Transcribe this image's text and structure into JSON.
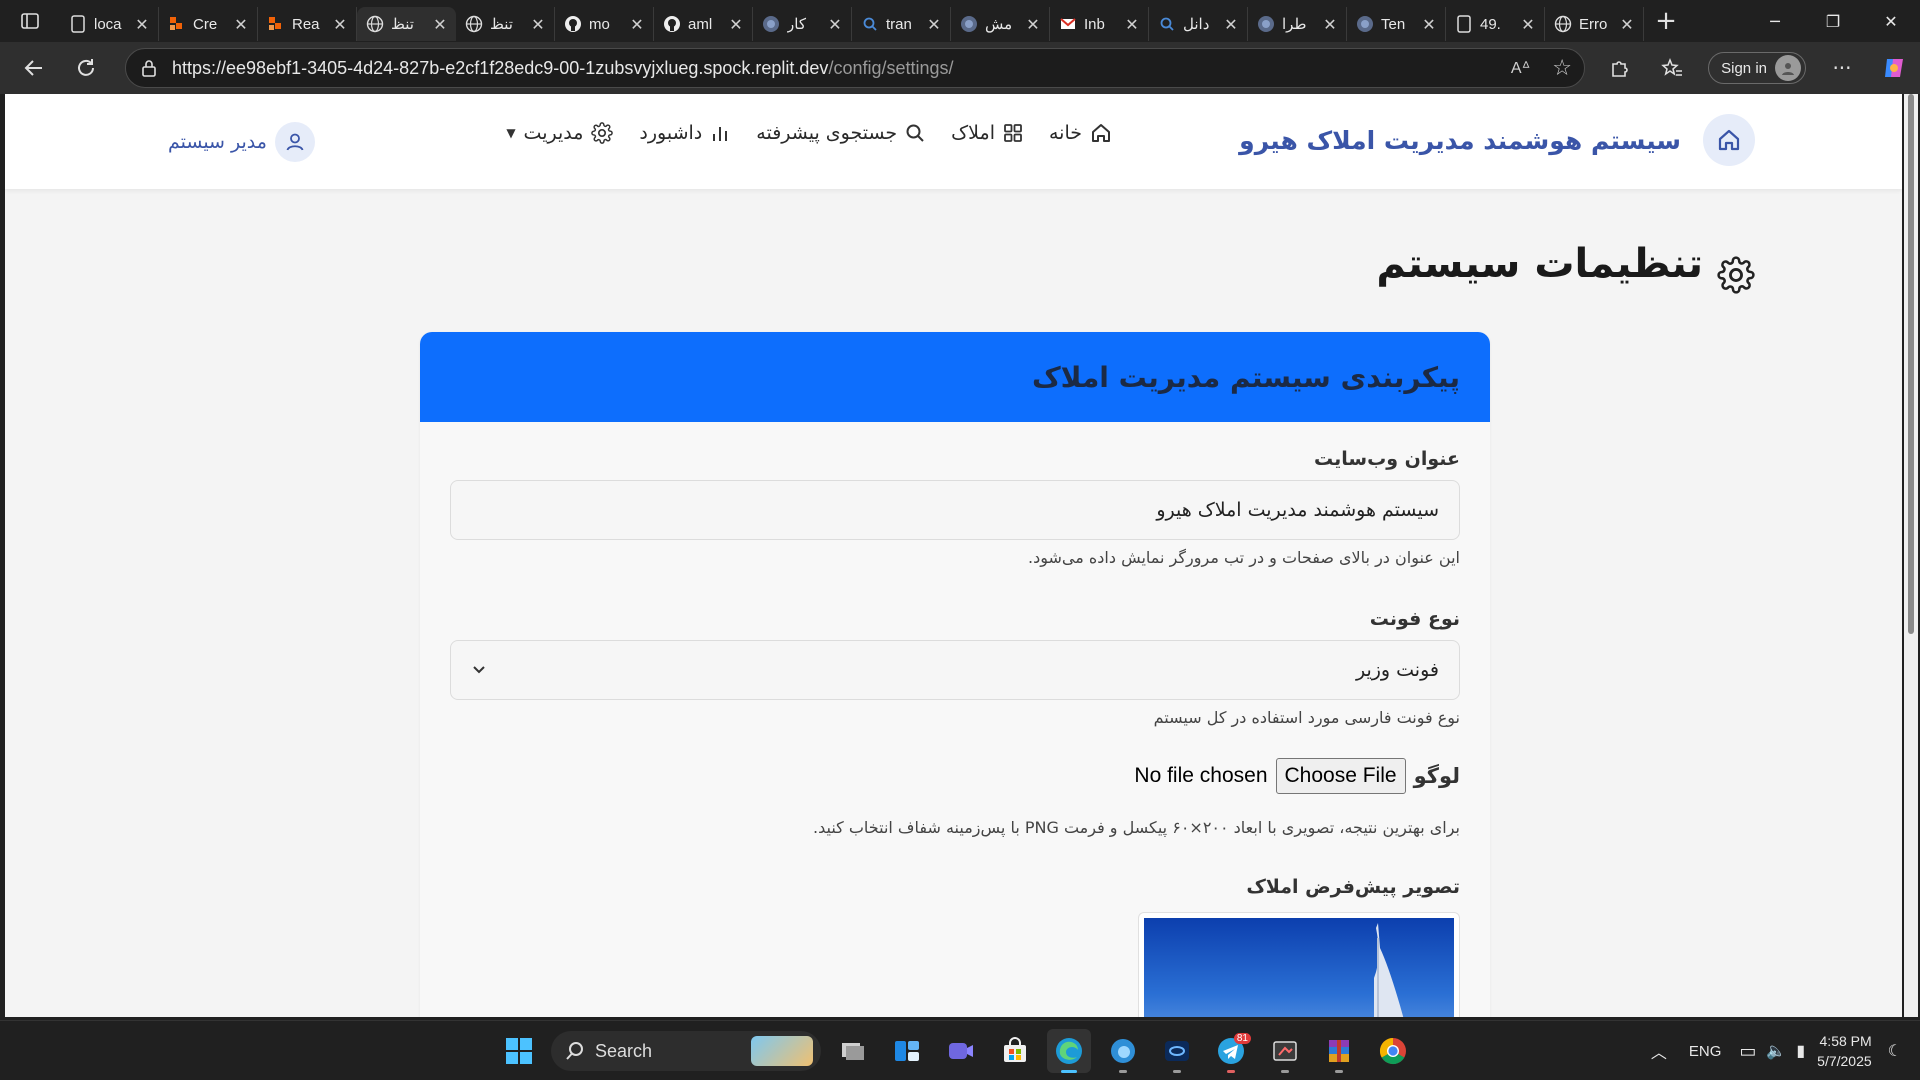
{
  "browser": {
    "tabs": [
      {
        "title": "loca",
        "icon": "page-icon"
      },
      {
        "title": "Cre",
        "icon": "orange-app-icon"
      },
      {
        "title": "Rea",
        "icon": "orange-app-icon"
      },
      {
        "title": "تنظ",
        "icon": "globe-icon",
        "active": true
      },
      {
        "title": "تنظ",
        "icon": "globe-icon"
      },
      {
        "title": "mo",
        "icon": "github-icon"
      },
      {
        "title": "aml",
        "icon": "github-icon"
      },
      {
        "title": "کار",
        "icon": "app-icon"
      },
      {
        "title": "tran",
        "icon": "search-icon"
      },
      {
        "title": "مش",
        "icon": "app-icon"
      },
      {
        "title": "Inb",
        "icon": "gmail-icon"
      },
      {
        "title": "دانل",
        "icon": "search-icon"
      },
      {
        "title": "طرا",
        "icon": "app-icon"
      },
      {
        "title": "Ten",
        "icon": "app-icon"
      },
      {
        "title": "49.",
        "icon": "page-icon"
      },
      {
        "title": "Erro",
        "icon": "globe-icon"
      }
    ],
    "url_main": "https://ee98ebf1-3405-4d24-827b-e2cf1f28edc9-00-1zubsvyjxlueg.spock.replit.dev",
    "url_path": "/config/settings/",
    "signin_label": "Sign in"
  },
  "site": {
    "brand": "سیستم هوشمند مدیریت املاک هیرو",
    "menu": [
      {
        "label": "خانه",
        "icon": "home-icon"
      },
      {
        "label": "املاک",
        "icon": "grid-icon"
      },
      {
        "label": "جستجوی پیشرفته",
        "icon": "search-icon"
      },
      {
        "label": "داشبورد",
        "icon": "bar-chart-icon"
      },
      {
        "label": "مدیریت",
        "icon": "gear-icon"
      }
    ],
    "user": "مدیر سیستم"
  },
  "page": {
    "title": "تنظیمات سیستم",
    "card_title": "پیکربندی سیستم مدیریت املاک",
    "fields": {
      "site_title_label": "عنوان وب‌سایت",
      "site_title_value": "سیستم هوشمند مدیریت املاک هیرو",
      "site_title_help": "این عنوان در بالای صفحات و در تب مرورگر نمایش داده می‌شود.",
      "font_label": "نوع فونت",
      "font_value": "فونت وزیر",
      "font_help": "نوع فونت فارسی مورد استفاده در کل سیستم",
      "logo_label": "لوگو",
      "logo_button": "Choose File",
      "logo_status": "No file chosen",
      "logo_help": "برای بهترین نتیجه، تصویری با ابعاد ۲۰۰×۶۰ پیکسل و فرمت PNG با پس‌زمینه شفاف انتخاب کنید.",
      "default_image_label": "تصویر پیش‌فرض املاک"
    }
  },
  "taskbar": {
    "search_label": "Search",
    "lang": "ENG",
    "time": "4:58 PM",
    "date": "5/7/2025",
    "telegram_badge": "81"
  }
}
